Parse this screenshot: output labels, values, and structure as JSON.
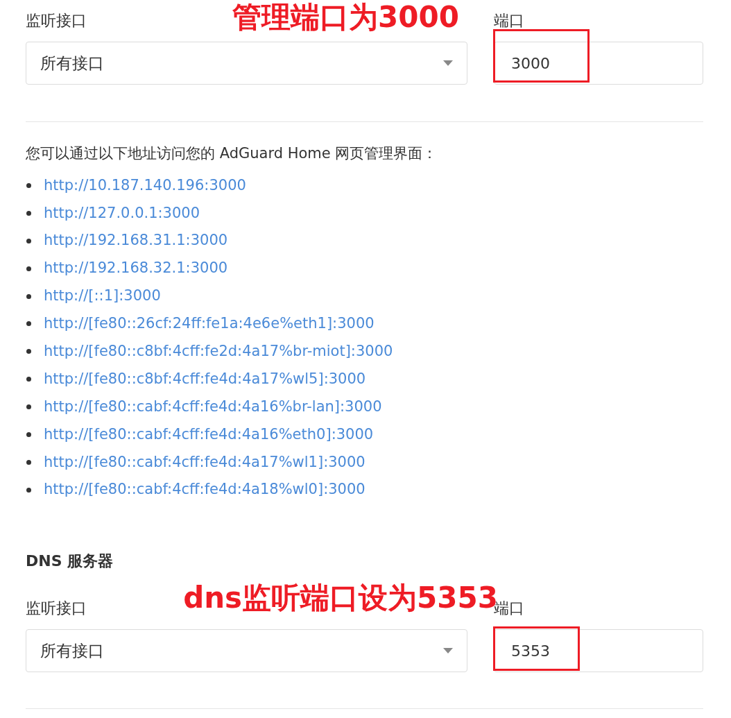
{
  "web_interface": {
    "interface_label": "监听接口",
    "interface_value": "所有接口",
    "port_label": "端口",
    "port_value": "3000"
  },
  "access_info": {
    "text": "您可以通过以下地址访问您的 AdGuard Home 网页管理界面：",
    "links": [
      "http://10.187.140.196:3000",
      "http://127.0.0.1:3000",
      "http://192.168.31.1:3000",
      "http://192.168.32.1:3000",
      "http://[::1]:3000",
      "http://[fe80::26cf:24ff:fe1a:4e6e%eth1]:3000",
      "http://[fe80::c8bf:4cff:fe2d:4a17%br-miot]:3000",
      "http://[fe80::c8bf:4cff:fe4d:4a17%wl5]:3000",
      "http://[fe80::cabf:4cff:fe4d:4a16%br-lan]:3000",
      "http://[fe80::cabf:4cff:fe4d:4a16%eth0]:3000",
      "http://[fe80::cabf:4cff:fe4d:4a17%wl1]:3000",
      "http://[fe80::cabf:4cff:fe4d:4a18%wl0]:3000"
    ]
  },
  "dns_server": {
    "title": "DNS 服务器",
    "interface_label": "监听接口",
    "interface_value": "所有接口",
    "port_label": "端口",
    "port_value": "5353"
  },
  "annotations": [
    "管理端口为3000",
    "dns监听端口设为5353"
  ]
}
